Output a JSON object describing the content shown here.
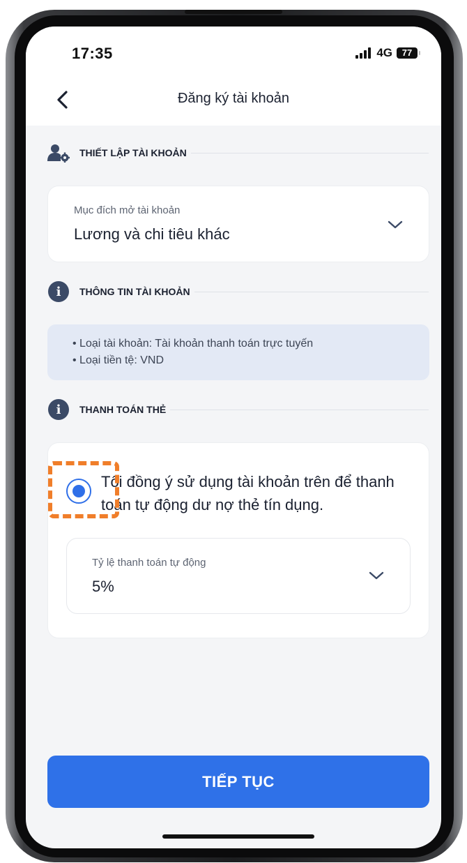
{
  "status_bar": {
    "time": "17:35",
    "network": "4G",
    "battery": "77"
  },
  "header": {
    "title": "Đăng ký tài khoản",
    "back_icon": "chevron-left-icon"
  },
  "sections": {
    "account_setup": {
      "title": "THIẾT LẬP TÀI KHOẢN",
      "icon": "user-gear-icon",
      "purpose_label": "Mục đích mở tài khoản",
      "purpose_value": "Lương và chi tiêu khác"
    },
    "account_info": {
      "title": "THÔNG TIN TÀI KHOẢN",
      "icon": "info-icon",
      "lines": [
        "• Loại tài khoản: Tài khoản thanh toán trực tuyến",
        "• Loại tiền tệ: VND"
      ]
    },
    "card_payment": {
      "title": "THANH TOÁN THẺ",
      "icon": "info-icon",
      "consent_text": "Tôi đồng ý sử dụng tài khoản trên để thanh toán tự động dư nợ thẻ tín dụng.",
      "consent_selected": true,
      "rate_label": "Tỷ lệ thanh toán tự động",
      "rate_value": "5%"
    }
  },
  "footer": {
    "continue_label": "TIẾP TỤC"
  },
  "colors": {
    "accent": "#2f71e8",
    "highlight": "#f07e2a",
    "background": "#f4f5f7",
    "info_box": "#e3e9f5"
  }
}
